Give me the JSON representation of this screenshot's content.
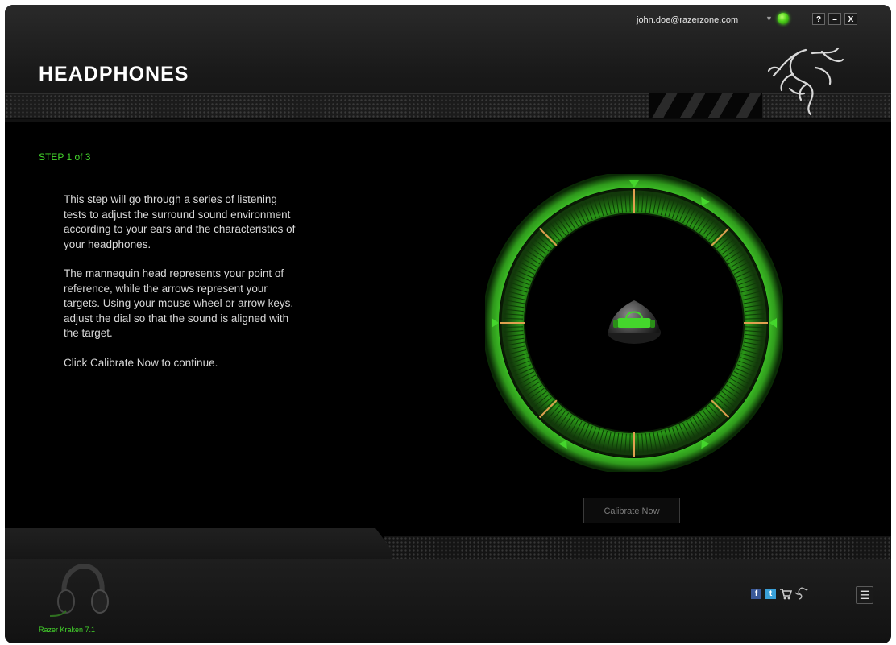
{
  "header": {
    "title": "HEADPHONES",
    "user_email": "john.doe@razerzone.com",
    "help_label": "?",
    "minimize_label": "–",
    "close_label": "X"
  },
  "content": {
    "step_label": "STEP 1 of 3",
    "paragraphs": [
      "This step will go through a series of listening tests to adjust the surround sound environment according to your ears and the characteristics of your headphones.",
      "The mannequin head represents your point of reference, while the arrows represent your targets. Using your mouse wheel or arrow keys, adjust the dial so that the sound is aligned with the target.",
      "Click Calibrate Now to continue."
    ],
    "calibrate_label": "Calibrate Now"
  },
  "footer": {
    "device_name": "Razer Kraken 7.1",
    "social": {
      "facebook": "f",
      "twitter": "t"
    },
    "menu_label": "☰"
  },
  "icons": [
    "razer-snake-logo-icon",
    "status-dot-icon",
    "chevron-down-icon",
    "mannequin-head-icon",
    "headset-icon",
    "facebook-icon",
    "twitter-icon",
    "cart-icon",
    "razer-small-icon",
    "menu-icon"
  ],
  "colors": {
    "accent": "#44d62c",
    "background": "#000000",
    "tick": "#e0a050"
  }
}
